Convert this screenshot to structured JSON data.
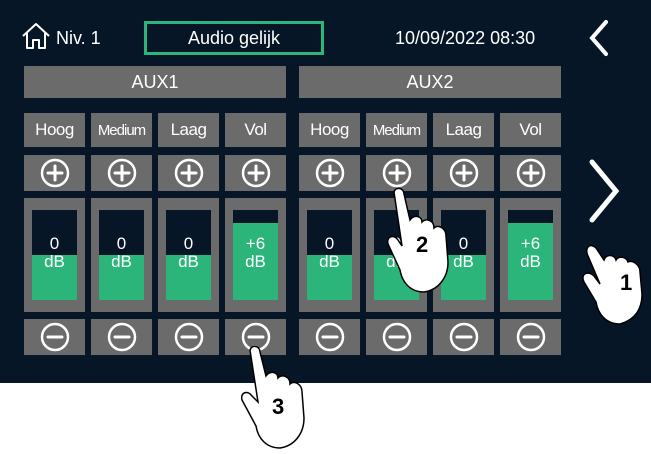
{
  "header": {
    "level": "Niv. 1",
    "mode": "Audio gelijk",
    "datetime": "10/09/2022 08:30"
  },
  "groups": [
    {
      "name": "AUX1",
      "columns": [
        {
          "label": "Hoog",
          "value": "0",
          "unit": "dB",
          "level": 0.5
        },
        {
          "label": "Medium",
          "value": "0",
          "unit": "dB",
          "level": 0.5
        },
        {
          "label": "Laag",
          "value": "0",
          "unit": "dB",
          "level": 0.5
        },
        {
          "label": "Vol",
          "value": "+6",
          "unit": "dB",
          "level": 0.85
        }
      ]
    },
    {
      "name": "AUX2",
      "columns": [
        {
          "label": "Hoog",
          "value": "0",
          "unit": "dB",
          "level": 0.5
        },
        {
          "label": "Medium",
          "value": "0",
          "unit": "dB",
          "level": 0.5
        },
        {
          "label": "Laag",
          "value": "0",
          "unit": "dB",
          "level": 0.5
        },
        {
          "label": "Vol",
          "value": "+6",
          "unit": "dB",
          "level": 0.85
        }
      ]
    }
  ],
  "callouts": [
    "1",
    "2",
    "3"
  ],
  "colors": {
    "accent": "#2bb57a",
    "panel": "#6b6b6b",
    "background": "#071626"
  },
  "icons": [
    "home-icon",
    "chevron-left-icon",
    "chevron-right-icon",
    "plus-circle-icon",
    "minus-circle-icon",
    "pointing-hand-icon"
  ]
}
